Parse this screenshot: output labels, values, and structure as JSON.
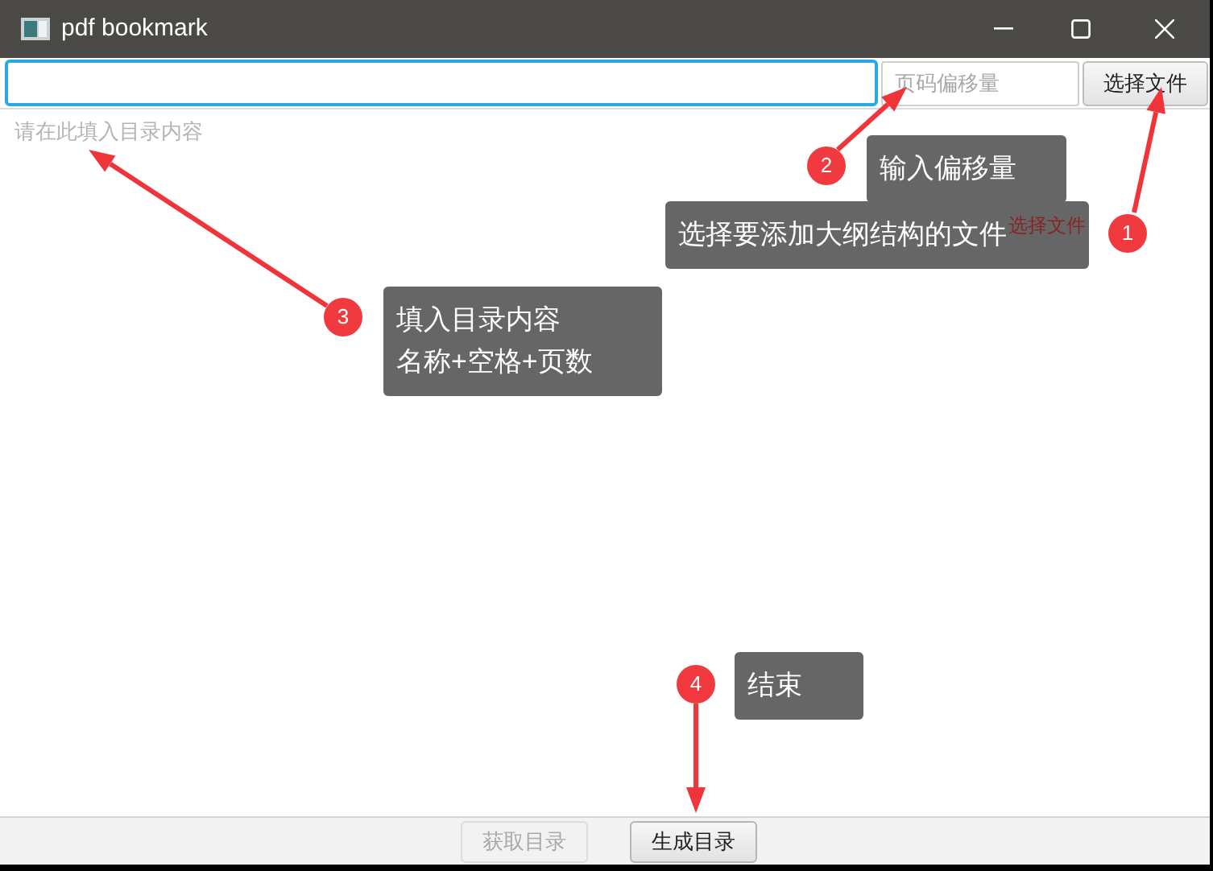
{
  "window": {
    "title": "pdf bookmark"
  },
  "toolbar": {
    "path_field": {
      "focused": true
    },
    "offset_field": {
      "placeholder": "页码偏移量"
    },
    "choose_button": {
      "label": "选择文件"
    }
  },
  "editor": {
    "placeholder": "请在此填入目录内容"
  },
  "footer_buttons": [
    {
      "label": "获取目录",
      "disabled": true
    },
    {
      "label": "生成目录",
      "disabled": false
    }
  ],
  "stray_text": "选择文件",
  "annotations": [
    {
      "number": "2",
      "lines": [
        "输入偏移量"
      ]
    },
    {
      "number": "1",
      "lines": [
        "选择要添加大纲结构的文件"
      ]
    },
    {
      "number": "3",
      "lines": [
        "填入目录内容",
        "名称+空格+页数"
      ]
    },
    {
      "number": "4",
      "lines": [
        "结束"
      ]
    }
  ]
}
